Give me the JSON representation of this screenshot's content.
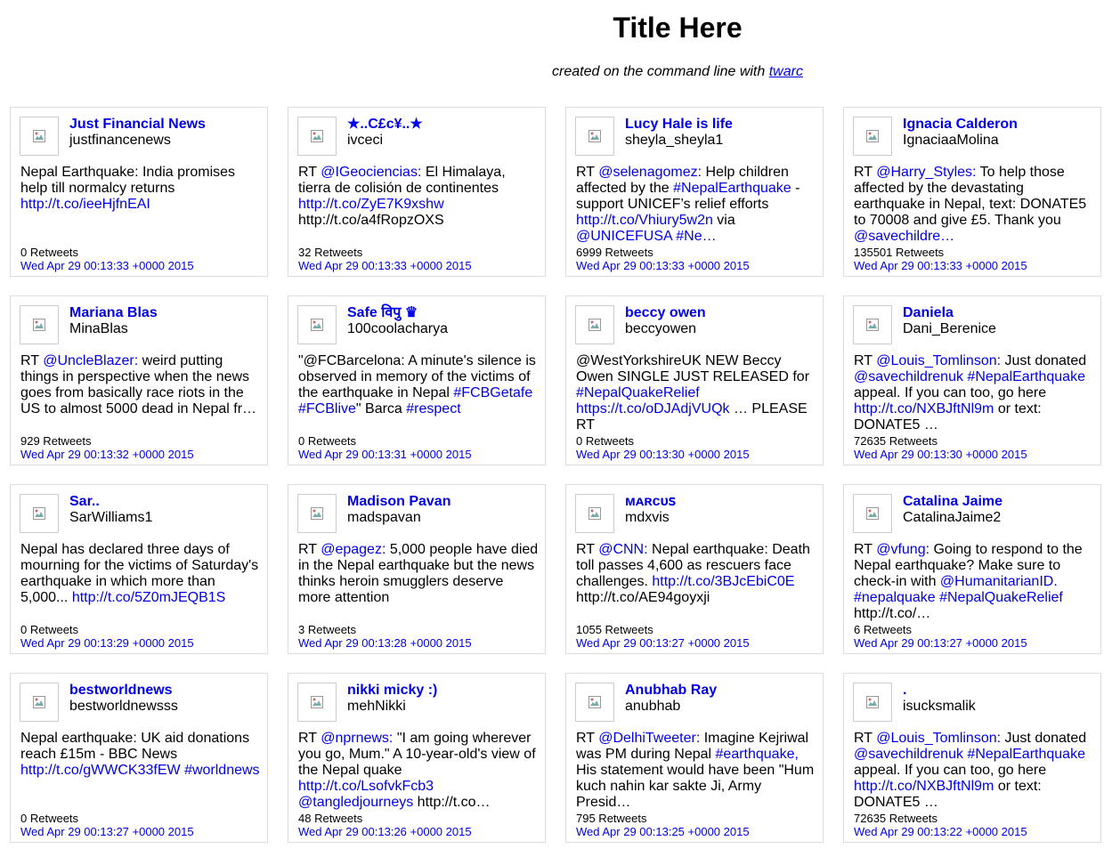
{
  "page": {
    "title": "Title Here",
    "subtitle_prefix": "created on the command line with ",
    "subtitle_link": "twarc"
  },
  "colors": {
    "link": "#0000ee",
    "border": "#dddddd"
  },
  "tweets": [
    {
      "name": "Just Financial News",
      "handle": "justfinancenews",
      "text": [
        {
          "t": "Nepal Earthquake: India promises help till normalcy returns "
        },
        {
          "t": "http://t.co/ieeHjfnEAI",
          "link": true
        }
      ],
      "retweets": "0 Retweets",
      "date": "Wed Apr 29 00:13:33 +0000 2015"
    },
    {
      "name": "★..C£c¥..★",
      "handle": "ivceci",
      "text": [
        {
          "t": "RT "
        },
        {
          "t": "@IGeociencias:",
          "link": true
        },
        {
          "t": " El Himalaya, tierra de colisión de continentes "
        },
        {
          "t": "http://t.co/ZyE7K9xshw",
          "link": true
        },
        {
          "t": " http://t.co/a4fRopzOXS"
        }
      ],
      "retweets": "32 Retweets",
      "date": "Wed Apr 29 00:13:33 +0000 2015"
    },
    {
      "name": "Lucy Hale is life",
      "handle": "sheyla_sheyla1",
      "text": [
        {
          "t": "RT "
        },
        {
          "t": "@selenagomez:",
          "link": true
        },
        {
          "t": " Help children affected by the "
        },
        {
          "t": "#NepalEarthquake",
          "link": true
        },
        {
          "t": " - support UNICEF’s relief efforts "
        },
        {
          "t": "http://t.co/Vhiury5w2n",
          "link": true
        },
        {
          "t": " via "
        },
        {
          "t": "@UNICEFUSA",
          "link": true
        },
        {
          "t": " "
        },
        {
          "t": "#Ne…",
          "link": true
        }
      ],
      "retweets": "6999 Retweets",
      "date": "Wed Apr 29 00:13:33 +0000 2015"
    },
    {
      "name": "Ignacia Calderon",
      "handle": "IgnaciaaMolina",
      "text": [
        {
          "t": "RT "
        },
        {
          "t": "@Harry_Styles:",
          "link": true
        },
        {
          "t": " To help those affected by the devastating earthquake in Nepal, text: DONATE5 to 70008 and give £5. Thank you "
        },
        {
          "t": "@savechildre…",
          "link": true
        }
      ],
      "retweets": "135501 Retweets",
      "date": "Wed Apr 29 00:13:33 +0000 2015"
    },
    {
      "name": "Mariana Blas",
      "handle": "MinaBlas",
      "text": [
        {
          "t": "RT "
        },
        {
          "t": "@UncleBlazer:",
          "link": true
        },
        {
          "t": " weird putting things in perspective when the news goes from basically race riots in the US to almost 5000 dead in Nepal fr…"
        }
      ],
      "retweets": "929 Retweets",
      "date": "Wed Apr 29 00:13:32 +0000 2015"
    },
    {
      "name": "Safe विपु ♛",
      "handle": "100coolacharya",
      "text": [
        {
          "t": "\"@FCBarcelona: A minute's silence is observed in memory of the victims of the earthquake in Nepal "
        },
        {
          "t": "#FCBGetafe",
          "link": true
        },
        {
          "t": " "
        },
        {
          "t": "#FCBlive",
          "link": true
        },
        {
          "t": "\" Barca "
        },
        {
          "t": "#respect",
          "link": true
        }
      ],
      "retweets": "0 Retweets",
      "date": "Wed Apr 29 00:13:31 +0000 2015"
    },
    {
      "name": "beccy owen",
      "handle": "beccyowen",
      "text": [
        {
          "t": "@WestYorkshireUK NEW Beccy Owen SINGLE JUST RELEASED for "
        },
        {
          "t": "#NepalQuakeRelief",
          "link": true
        },
        {
          "t": " "
        },
        {
          "t": "https://t.co/oDJAdjVUQk",
          "link": true
        },
        {
          "t": " … PLEASE RT"
        }
      ],
      "retweets": "0 Retweets",
      "date": "Wed Apr 29 00:13:30 +0000 2015"
    },
    {
      "name": "Daniela",
      "handle": "Dani_Berenice",
      "text": [
        {
          "t": "RT "
        },
        {
          "t": "@Louis_Tomlinson:",
          "link": true
        },
        {
          "t": " Just donated "
        },
        {
          "t": "@savechildrenuk",
          "link": true
        },
        {
          "t": " "
        },
        {
          "t": "#NepalEarthquake",
          "link": true
        },
        {
          "t": " appeal. If you can too, go here "
        },
        {
          "t": "http://t.co/NXBJftNl9m",
          "link": true
        },
        {
          "t": " or text: DONATE5 …"
        }
      ],
      "retweets": "72635 Retweets",
      "date": "Wed Apr 29 00:13:30 +0000 2015"
    },
    {
      "name": "Sar..",
      "handle": "SarWilliams1",
      "text": [
        {
          "t": "Nepal has declared three days of mourning for the victims of Saturday's earthquake in which more than 5,000... "
        },
        {
          "t": "http://t.co/5Z0mJEQB1S",
          "link": true
        }
      ],
      "retweets": "0 Retweets",
      "date": "Wed Apr 29 00:13:29 +0000 2015"
    },
    {
      "name": "Madison Pavan",
      "handle": "madspavan",
      "text": [
        {
          "t": "RT "
        },
        {
          "t": "@epagez:",
          "link": true
        },
        {
          "t": " 5,000 people have died in the Nepal earthquake but the news thinks heroin smugglers deserve more attention"
        }
      ],
      "retweets": "3 Retweets",
      "date": "Wed Apr 29 00:13:28 +0000 2015"
    },
    {
      "name": "ᴍᴀʀᴄᴜꜱ",
      "handle": "mdxvis",
      "text": [
        {
          "t": "RT "
        },
        {
          "t": "@CNN:",
          "link": true
        },
        {
          "t": " Nepal earthquake: Death toll passes 4,600 as rescuers face challenges. "
        },
        {
          "t": "http://t.co/3BJcEbiC0E",
          "link": true
        },
        {
          "t": " http://t.co/AE94goyxji"
        }
      ],
      "retweets": "1055 Retweets",
      "date": "Wed Apr 29 00:13:27 +0000 2015"
    },
    {
      "name": "Catalina Jaime",
      "handle": "CatalinaJaime2",
      "text": [
        {
          "t": "RT "
        },
        {
          "t": "@vfung:",
          "link": true
        },
        {
          "t": " Going to respond to the Nepal earthquake? Make sure to check-in with "
        },
        {
          "t": "@HumanitarianID.",
          "link": true
        },
        {
          "t": " "
        },
        {
          "t": "#nepalquake",
          "link": true
        },
        {
          "t": " "
        },
        {
          "t": "#NepalQuakeRelief",
          "link": true
        },
        {
          "t": " http://t.co/…"
        }
      ],
      "retweets": "6 Retweets",
      "date": "Wed Apr 29 00:13:27 +0000 2015"
    },
    {
      "name": "bestworldnews",
      "handle": "bestworldnewsss",
      "text": [
        {
          "t": "Nepal earthquake: UK aid donations reach £15m - BBC News "
        },
        {
          "t": "http://t.co/gWWCK33fEW",
          "link": true
        },
        {
          "t": " "
        },
        {
          "t": "#worldnews",
          "link": true
        }
      ],
      "retweets": "0 Retweets",
      "date": "Wed Apr 29 00:13:27 +0000 2015"
    },
    {
      "name": "nikki micky :)",
      "handle": "mehNikki",
      "text": [
        {
          "t": "RT "
        },
        {
          "t": "@nprnews:",
          "link": true
        },
        {
          "t": " \"I am going wherever you go, Mum.\" A 10-year-old's view of the Nepal quake "
        },
        {
          "t": "http://t.co/LsofvkFcb3",
          "link": true
        },
        {
          "t": " "
        },
        {
          "t": "@tangledjourneys",
          "link": true
        },
        {
          "t": " http://t.co…"
        }
      ],
      "retweets": "48 Retweets",
      "date": "Wed Apr 29 00:13:26 +0000 2015"
    },
    {
      "name": "Anubhab Ray",
      "handle": "anubhab",
      "text": [
        {
          "t": "RT "
        },
        {
          "t": "@DelhiTweeter:",
          "link": true
        },
        {
          "t": " Imagine Kejriwal was PM during Nepal "
        },
        {
          "t": "#earthquake,",
          "link": true
        },
        {
          "t": " His statement would have been \"Hum kuch nahin kar sakte Ji, Army Presid…"
        }
      ],
      "retweets": "795 Retweets",
      "date": "Wed Apr 29 00:13:25 +0000 2015"
    },
    {
      "name": ".",
      "handle": "isucksmalik",
      "text": [
        {
          "t": "RT "
        },
        {
          "t": "@Louis_Tomlinson:",
          "link": true
        },
        {
          "t": " Just donated "
        },
        {
          "t": "@savechildrenuk",
          "link": true
        },
        {
          "t": " "
        },
        {
          "t": "#NepalEarthquake",
          "link": true
        },
        {
          "t": " appeal. If you can too, go here "
        },
        {
          "t": "http://t.co/NXBJftNl9m",
          "link": true
        },
        {
          "t": " or text: DONATE5 …"
        }
      ],
      "retweets": "72635 Retweets",
      "date": "Wed Apr 29 00:13:22 +0000 2015"
    }
  ]
}
